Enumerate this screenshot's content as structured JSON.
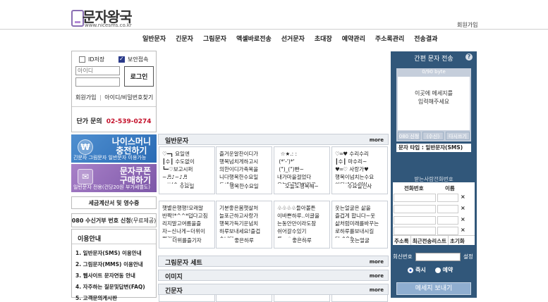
{
  "header": {
    "site_title": "문자왕국",
    "site_url": "www.nicesms.co.kr",
    "join_link": "회원가입"
  },
  "nav": [
    "일반문자",
    "긴문자",
    "그림문자",
    "액셀바로전송",
    "선거문자",
    "초대장",
    "예약관리",
    "주소록관리",
    "전송결과"
  ],
  "login": {
    "save_id_label": "ID저장",
    "secure_label": "보안접속",
    "id_placeholder": "아이디",
    "pw_placeholder": "",
    "login_button": "로그인",
    "join_label": "회원가입",
    "find_label": "아이디/비밀번호찾기",
    "price_label": "단가 문의",
    "price_phone": "02-539-0274"
  },
  "banners": {
    "nice_money": {
      "title1": "나이스머니",
      "title2": "충전하기",
      "sub": "긴문자 그림문자 일반문자 이용가능"
    },
    "coupon": {
      "title1": "문자쿠폰",
      "title2": "구매하기",
      "sub": "일반문자 전용(건당20원 부가세별도)"
    }
  },
  "side_buttons": {
    "tax": "세금계산서 및 영수증",
    "reject": "080 수신거부 번호 신청",
    "reject_note": "(무료제공)"
  },
  "guide": {
    "title": "이용안내",
    "items": [
      "1. 일반문자(SMS) 이용안내",
      "2. 그림문자(MMS) 이용안내",
      "3. 웹사이트 문자연동 안내",
      "4. 자주하는 질문및답변(FAQ)",
      "5. 고객문의게시판"
    ]
  },
  "sections": {
    "general": {
      "title": "일반문자",
      "more": "more"
    },
    "picture_set": {
      "title": "그림문자 세트",
      "more": "more"
    },
    "image": {
      "title": "이미지",
      "more": "more"
    },
    "long": {
      "title": "긴문자",
      "more": "more"
    }
  },
  "general_cards": [
    {
      "msg": "♡━┓ 요일엔\n┃수┃ 수도없이\n┗━♡보고시퍼\n~♬♪~♪♬\n~♡(^-^)♡~",
      "title": "수요일"
    },
    {
      "msg": "즐거운알찬이디가\n행복넘치게하고시\n의한이디가축복을\n니다행복한수요일\n드세요~",
      "title": "행복한수요일"
    },
    {
      "msg": "  ☆★.: :\n (*'-')*'\n (\")_(\")빤~\n내가마을걸었다\n오늘도행복하라고",
      "title": "오늘도행복해~"
    },
    {
      "msg": "♡═♥ 수리수리\n┃수┃ 마수리~\n♥═♡ 사랑가♥\n행복이넘치는수요\n이되세요! 얍!!",
      "title": "수요일인사"
    }
  ],
  "general_cards_row2": [
    {
      "msg": "햇볕은행행!모래알\n반짝!*^^*덥다고짐\n리지말고여름을즐\n자~신나게~더위이\n렷거라",
      "title": "더위를즐기자"
    },
    {
      "msg": "기분좋은봄햇살처\n늘포근하고사랑가\n행복가득기운넘치\n하루보내세요!즐겁\n습니다.",
      "title": "좋은하루"
    },
    {
      "msg": "♧♧♧♧들아볼튼\n이바쁜하루..이글을\n는동안만이라도잠\n쉬어갈수있기\n를...♧♧♧♧",
      "title": "좋은하루"
    },
    {
      "msg": "웃는얼굴은 삶을\n즐겁게 합니다~웃\n삶처럼미래를바꾸는\n로하루를보내시길\n다.^0^",
      "title": "웃는얼굴"
    }
  ],
  "quick_send": {
    "title": "간편 문자 전송",
    "help": "?",
    "bytes": "0/90 byte",
    "placeholder_line1": "이곳에 메세지를",
    "placeholder_line2": "입력해주세요",
    "btn_special": "080 신청",
    "btn_recv": "(수신)",
    "btn_reset": "다시쓰기",
    "type_label": "문자 타입 : 일반문자(SMS)",
    "recv_title": "받는사람전화번호",
    "col_phone": "전화번호",
    "col_name": "이름",
    "remove": "×",
    "tabs": [
      "주소록",
      "최근전송리스트",
      "초기화"
    ],
    "sender_label": "회신번호",
    "setting_label": "설정",
    "radio_now": "즉시",
    "radio_reserve": "예약",
    "send_button": "메세지 보내기"
  }
}
